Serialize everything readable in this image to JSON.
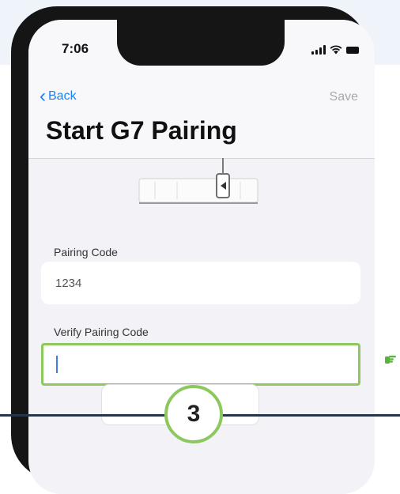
{
  "status_bar": {
    "time": "7:06",
    "icons": [
      "signal-icon",
      "wifi-icon",
      "battery-icon"
    ]
  },
  "nav": {
    "back_label": "Back",
    "save_label": "Save"
  },
  "page": {
    "title": "Start G7 Pairing"
  },
  "form": {
    "pairing_code_label": "Pairing Code",
    "pairing_code_value": "1234",
    "verify_label": "Verify Pairing Code",
    "verify_value": ""
  },
  "step_badge": "3",
  "colors": {
    "accent_blue": "#1a82f7",
    "highlight_green": "#8dc85e",
    "disabled_gray": "#a9a9a9",
    "screen_bg": "#f2f2f7"
  }
}
